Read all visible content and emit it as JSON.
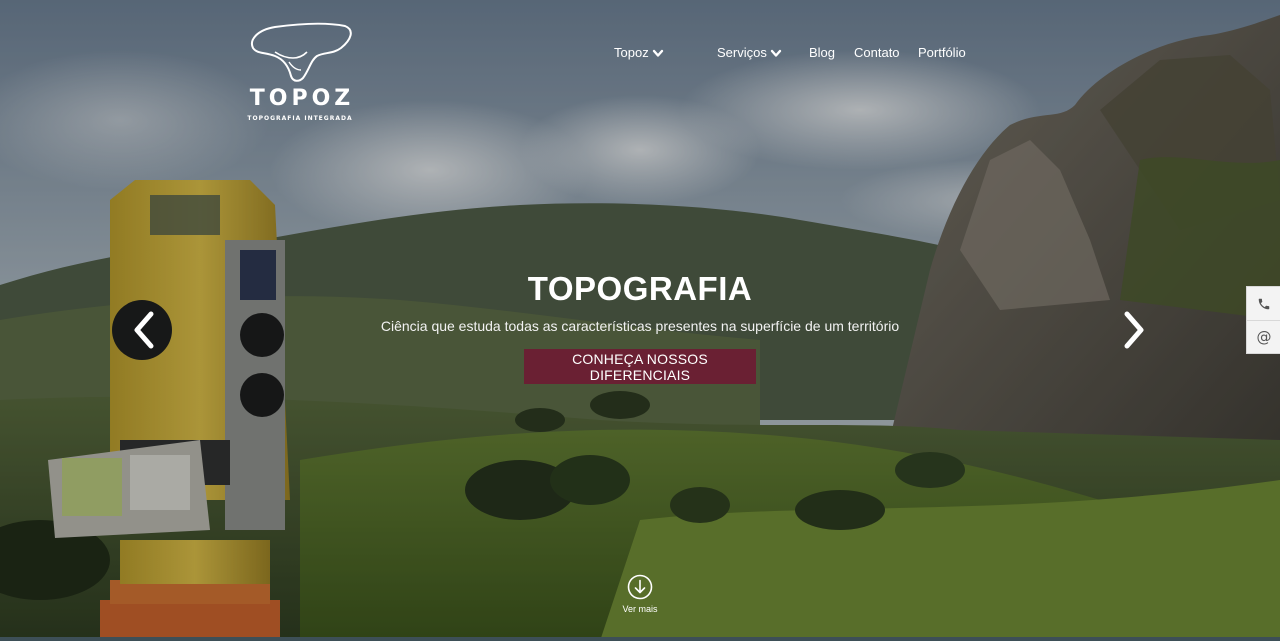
{
  "brand": {
    "name": "TOPOZ",
    "tagline": "TOPOGRAFIA INTEGRADA",
    "logo_icon": "saddle-mountain-logo"
  },
  "nav": {
    "items": [
      {
        "label": "Topoz",
        "has_dropdown": true,
        "icon": "chevron-down-icon"
      },
      {
        "label": "Serviços",
        "has_dropdown": true,
        "icon": "chevron-down-icon"
      },
      {
        "label": "Blog",
        "has_dropdown": false
      },
      {
        "label": "Contato",
        "has_dropdown": false
      },
      {
        "label": "Portfólio",
        "has_dropdown": false
      }
    ]
  },
  "slide": {
    "title": "TOPOGRAFIA",
    "subtitle": "Ciência que estuda todas as características presentes na superfície de um território",
    "cta_label": "CONHEÇA NOSSOS DIFERENCIAIS",
    "prev_icon": "chevron-left-icon",
    "next_icon": "chevron-right-icon"
  },
  "scroll_hint": {
    "label": "Ver mais",
    "icon": "arrow-down-circle-icon"
  },
  "side_contact": {
    "phone_icon": "phone-icon",
    "email_icon": "at-sign-icon",
    "email_glyph": "@"
  },
  "colors": {
    "cta_background": "#6a2033",
    "text": "#ffffff",
    "side_tab_background": "#f3f3f3"
  }
}
